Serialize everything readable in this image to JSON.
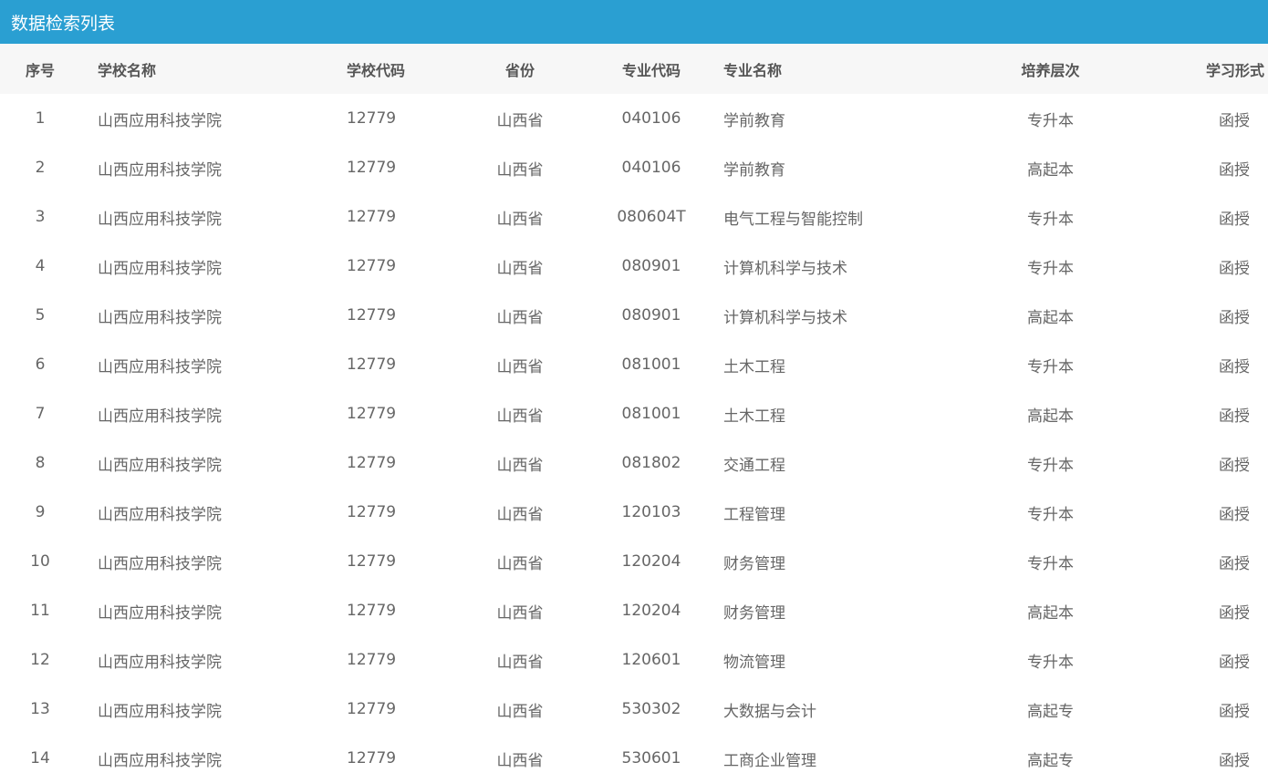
{
  "title": "数据检索列表",
  "headers": [
    "序号",
    "学校名称",
    "学校代码",
    "省份",
    "专业代码",
    "专业名称",
    "培养层次",
    "学习形式"
  ],
  "rows": [
    [
      "1",
      "山西应用科技学院",
      "12779",
      "山西省",
      "040106",
      "学前教育",
      "专升本",
      "函授"
    ],
    [
      "2",
      "山西应用科技学院",
      "12779",
      "山西省",
      "040106",
      "学前教育",
      "高起本",
      "函授"
    ],
    [
      "3",
      "山西应用科技学院",
      "12779",
      "山西省",
      "080604T",
      "电气工程与智能控制",
      "专升本",
      "函授"
    ],
    [
      "4",
      "山西应用科技学院",
      "12779",
      "山西省",
      "080901",
      "计算机科学与技术",
      "专升本",
      "函授"
    ],
    [
      "5",
      "山西应用科技学院",
      "12779",
      "山西省",
      "080901",
      "计算机科学与技术",
      "高起本",
      "函授"
    ],
    [
      "6",
      "山西应用科技学院",
      "12779",
      "山西省",
      "081001",
      "土木工程",
      "专升本",
      "函授"
    ],
    [
      "7",
      "山西应用科技学院",
      "12779",
      "山西省",
      "081001",
      "土木工程",
      "高起本",
      "函授"
    ],
    [
      "8",
      "山西应用科技学院",
      "12779",
      "山西省",
      "081802",
      "交通工程",
      "专升本",
      "函授"
    ],
    [
      "9",
      "山西应用科技学院",
      "12779",
      "山西省",
      "120103",
      "工程管理",
      "专升本",
      "函授"
    ],
    [
      "10",
      "山西应用科技学院",
      "12779",
      "山西省",
      "120204",
      "财务管理",
      "专升本",
      "函授"
    ],
    [
      "11",
      "山西应用科技学院",
      "12779",
      "山西省",
      "120204",
      "财务管理",
      "高起本",
      "函授"
    ],
    [
      "12",
      "山西应用科技学院",
      "12779",
      "山西省",
      "120601",
      "物流管理",
      "专升本",
      "函授"
    ],
    [
      "13",
      "山西应用科技学院",
      "12779",
      "山西省",
      "530302",
      "大数据与会计",
      "高起专",
      "函授"
    ],
    [
      "14",
      "山西应用科技学院",
      "12779",
      "山西省",
      "530601",
      "工商企业管理",
      "高起专",
      "函授"
    ]
  ]
}
